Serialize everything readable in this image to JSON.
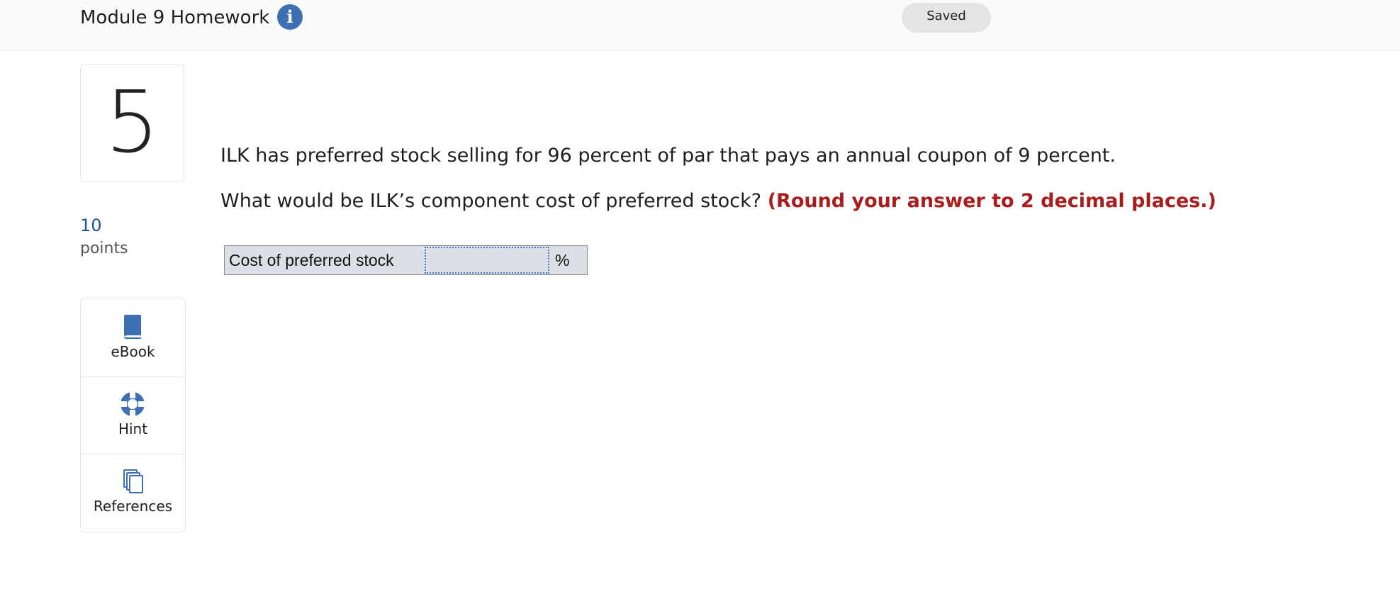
{
  "header": {
    "title": "Module 9 Homework",
    "info_icon": "info-icon",
    "status": "Saved"
  },
  "question": {
    "number": "5",
    "points_value": "10",
    "points_label": "points",
    "text_1": "ILK has preferred stock selling for 96 percent of par that pays an annual coupon of 9 percent.",
    "text_2": "What would be ILK’s component cost of preferred stock?",
    "instruction": "(Round your answer to 2 decimal places.)"
  },
  "tools": [
    {
      "label": "eBook",
      "icon": "book-icon"
    },
    {
      "label": "Hint",
      "icon": "lifebuoy-icon"
    },
    {
      "label": "References",
      "icon": "copy-documents-icon"
    }
  ],
  "answer": {
    "label": "Cost of preferred stock",
    "value": "",
    "unit": "%"
  },
  "colors": {
    "accent_blue": "#3f6fb3",
    "instruction_red": "#a91d1d",
    "points_blue": "#1e4f8f",
    "answer_bg": "#dcdfe6"
  }
}
